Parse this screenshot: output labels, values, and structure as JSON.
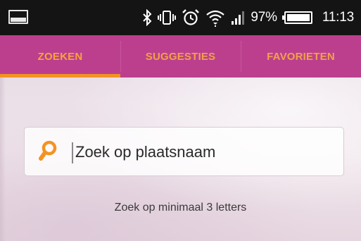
{
  "status_bar": {
    "battery_percent": "97%",
    "time": "11:13",
    "icons": [
      "notification-icon",
      "bluetooth-icon",
      "vibrate-icon",
      "alarm-icon",
      "wifi-icon",
      "signal-icon",
      "battery-icon"
    ]
  },
  "tabs": [
    {
      "label": "ZOEKEN",
      "active": true
    },
    {
      "label": "SUGGESTIES",
      "active": false
    },
    {
      "label": "FAVORIETEN",
      "active": false
    }
  ],
  "search": {
    "placeholder": "Zoek op plaatsnaam",
    "value": ""
  },
  "hint": "Zoek op minimaal 3 letters",
  "colors": {
    "status_bar": "#141414",
    "tab_bar": "#bc3f8e",
    "tab_text": "#f0a24a",
    "tab_indicator": "#f39322",
    "search_icon": "#f39322"
  }
}
